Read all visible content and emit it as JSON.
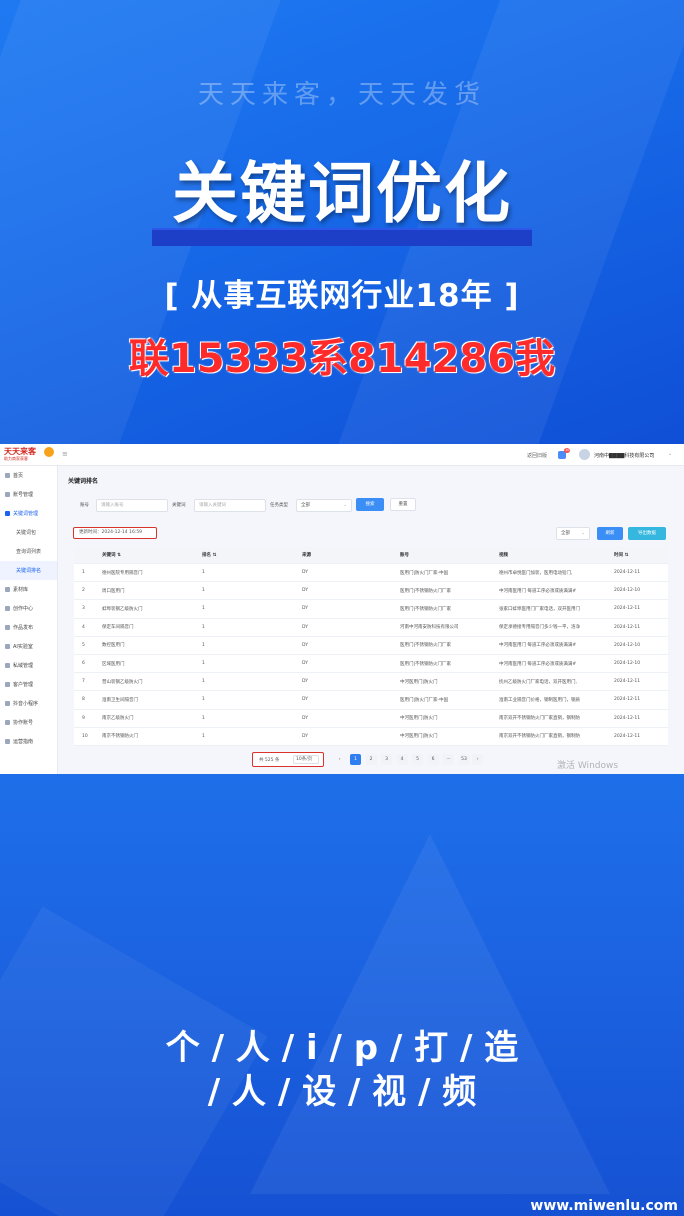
{
  "banner_top": {
    "slogan": "天天来客，天天发货",
    "headline": "关键词优化",
    "subline": "[ 从事互联网行业18年 ]",
    "contact": "联15333系814286我"
  },
  "app": {
    "logo_main": "天天来客",
    "logo_sub": "助力商家获客",
    "header": {
      "home_link": "返回旧版",
      "notification_count": "10",
      "company": "河南中▇▇▇▇科技有限公司"
    },
    "sidebar": [
      {
        "label": "首页",
        "icon": "home-icon"
      },
      {
        "label": "账号管理",
        "icon": "users-icon"
      },
      {
        "label": "关键词管理",
        "icon": "tag-icon",
        "open": true
      },
      {
        "label": "关键词包",
        "sub": true
      },
      {
        "label": "查询词列表",
        "sub": true
      },
      {
        "label": "关键词排名",
        "sub": true,
        "active": true
      },
      {
        "label": "素材库",
        "icon": "folder-icon"
      },
      {
        "label": "创作中心",
        "icon": "pen-icon"
      },
      {
        "label": "作品发布",
        "icon": "upload-icon"
      },
      {
        "label": "AI实验室",
        "icon": "ai-icon"
      },
      {
        "label": "私域管理",
        "icon": "chat-icon"
      },
      {
        "label": "客户管理",
        "icon": "person-icon"
      },
      {
        "label": "抖音小程序",
        "icon": "app-icon"
      },
      {
        "label": "协作账号",
        "icon": "team-icon"
      },
      {
        "label": "运营指南",
        "icon": "book-icon"
      }
    ],
    "page_title": "关键词排名",
    "filters": {
      "account_label": "账号",
      "account_placeholder": "请输入账号",
      "keyword_label": "关键词",
      "keyword_placeholder": "请输入关键词",
      "type_label": "任务类型",
      "type_value": "全部",
      "search_button": "搜索",
      "reset_button": "重置"
    },
    "update_time": "更新时间：2024-12-14 16:59",
    "toolbar": {
      "select_value": "全部",
      "refresh_button": "刷新",
      "export_button": "导出数据"
    },
    "table": {
      "headers": [
        "",
        "关键词 ⇅",
        "排名 ⇅",
        "来源",
        "账号",
        "视频",
        "时间 ⇅"
      ],
      "rows": [
        [
          "1",
          "德州医院专用隔音门",
          "1",
          "DY",
          "医用门|防火门厂家-中国",
          "德州市卓悦医门加装，医用电动铅门,",
          "2024-12-11"
        ],
        [
          "2",
          "周口医用门",
          "1",
          "DY",
          "医用门|不锈钢防火门厂家",
          "中河南医用门 每道工序必须或质满满#",
          "2024-12-10"
        ],
        [
          "3",
          "蚌埠装钢乙级防火门",
          "1",
          "DY",
          "医用门|不锈钢防火门厂家",
          "张家口蚌埠医用门厂家电话，双开医用门",
          "2024-12-11"
        ],
        [
          "4",
          "保定车间隔音门",
          "1",
          "DY",
          "河南中河南安防科技有限公司",
          "保定承德接专用隔音门多少钱一平，洛净",
          "2024-12-11"
        ],
        [
          "5",
          "数控医用门",
          "1",
          "DY",
          "医用门|不锈钢防火门厂家",
          "中河南医用门 每道工序必须或质满满#",
          "2024-12-10"
        ],
        [
          "6",
          "区域医用门",
          "1",
          "DY",
          "医用门|不锈钢防火门厂家",
          "中河南医用门 每道工序必须或质满满#",
          "2024-12-10"
        ],
        [
          "7",
          "营山装钢乙级防火门",
          "1",
          "DY",
          "中河医用门|防火门",
          "抚州乙级防火门厂家电话，双开医用门,",
          "2024-12-11"
        ],
        [
          "8",
          "淮南卫生间隔音门",
          "1",
          "DY",
          "医用门|防火门厂家-中国",
          "淮南工业隔音门价格，钢制医用门，钢质",
          "2024-12-11"
        ],
        [
          "9",
          "南京乙级防火门",
          "1",
          "DY",
          "中河医用门|防火门",
          "南京双开不锈钢防火门厂家直销，钢制防",
          "2024-12-11"
        ],
        [
          "10",
          "南京不锈钢防火门",
          "1",
          "DY",
          "中河医用门|防火门",
          "南京双开不锈钢防火门厂家直销，钢制防",
          "2024-12-11"
        ]
      ]
    },
    "pagination": {
      "total": "共 525 条",
      "page_size": "10条/页",
      "prev": "‹",
      "pages": [
        "1",
        "2",
        "3",
        "4",
        "5",
        "6",
        "···",
        "53"
      ],
      "next": "›",
      "current": "1"
    },
    "os_watermark": "激活 Windows"
  },
  "banner_bottom": {
    "line1": "个 / 人 / i / p / 打 / 造",
    "line2": "/ 人 / 设 / 视 / 频",
    "site": "www.miwenlu.com"
  },
  "colors": {
    "banner_blue": "#1769e8",
    "contact_red": "#ff2b2b",
    "primary_button": "#3a8ef6",
    "highlight_box": "#d9342b"
  }
}
